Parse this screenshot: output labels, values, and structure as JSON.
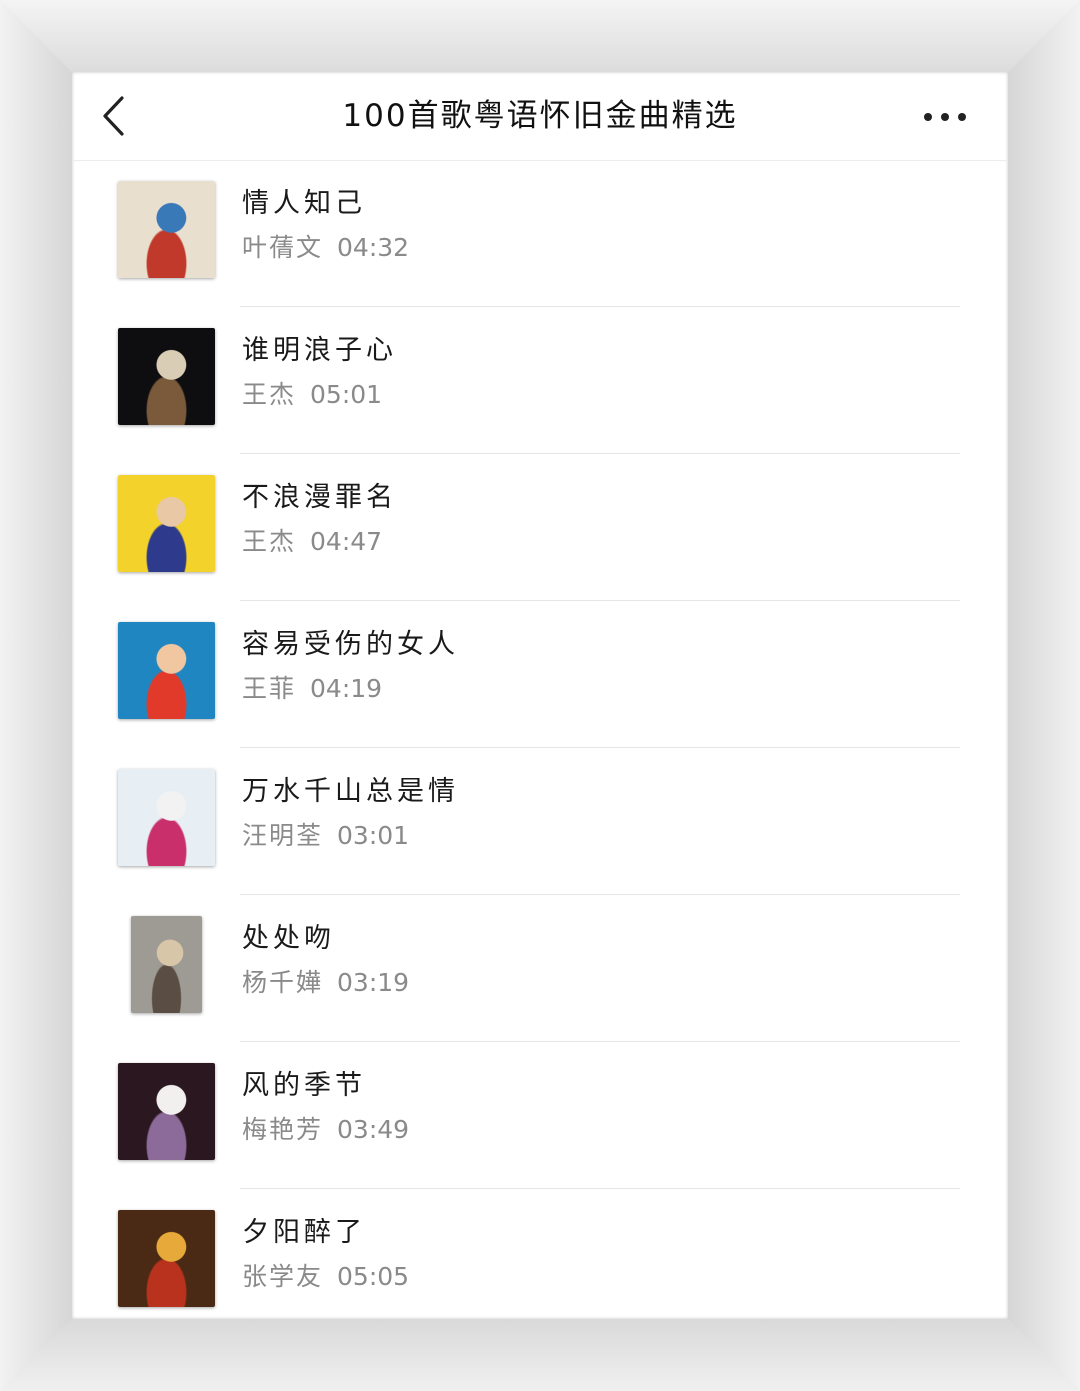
{
  "header": {
    "title": "100首歌粤语怀旧金曲精选"
  },
  "songs": [
    {
      "title": "情人知己",
      "artist": "叶蒨文",
      "duration": "04:32",
      "cover": {
        "bg": "#e9dfcf",
        "accent": "#3a79b8",
        "accent2": "#c0392b"
      }
    },
    {
      "title": "谁明浪子心",
      "artist": "王杰",
      "duration": "05:01",
      "cover": {
        "bg": "#0e0d10",
        "accent": "#d9cdb6",
        "accent2": "#7a5a3a"
      }
    },
    {
      "title": "不浪漫罪名",
      "artist": "王杰",
      "duration": "04:47",
      "cover": {
        "bg": "#f2d22b",
        "accent": "#e9c8a6",
        "accent2": "#2e3a8c"
      }
    },
    {
      "title": "容易受伤的女人",
      "artist": "王菲",
      "duration": "04:19",
      "cover": {
        "bg": "#1f86c2",
        "accent": "#f0c7a0",
        "accent2": "#e23a2a"
      }
    },
    {
      "title": "万水千山总是情",
      "artist": "汪明荃",
      "duration": "03:01",
      "cover": {
        "bg": "#e7eef4",
        "accent": "#f2f2f2",
        "accent2": "#c9306b"
      }
    },
    {
      "title": "处处吻",
      "artist": "杨千嬅",
      "duration": "03:19",
      "cover": {
        "bg": "#9e9a94",
        "accent": "#d8c6a8",
        "accent2": "#5a4e44"
      }
    },
    {
      "title": "风的季节",
      "artist": "梅艳芳",
      "duration": "03:49",
      "cover": {
        "bg": "#2a1720",
        "accent": "#f2f0ee",
        "accent2": "#8c6a9a"
      }
    },
    {
      "title": "夕阳醉了",
      "artist": "张学友",
      "duration": "05:05",
      "cover": {
        "bg": "#4a2a14",
        "accent": "#e7a93a",
        "accent2": "#b8321e"
      }
    }
  ]
}
